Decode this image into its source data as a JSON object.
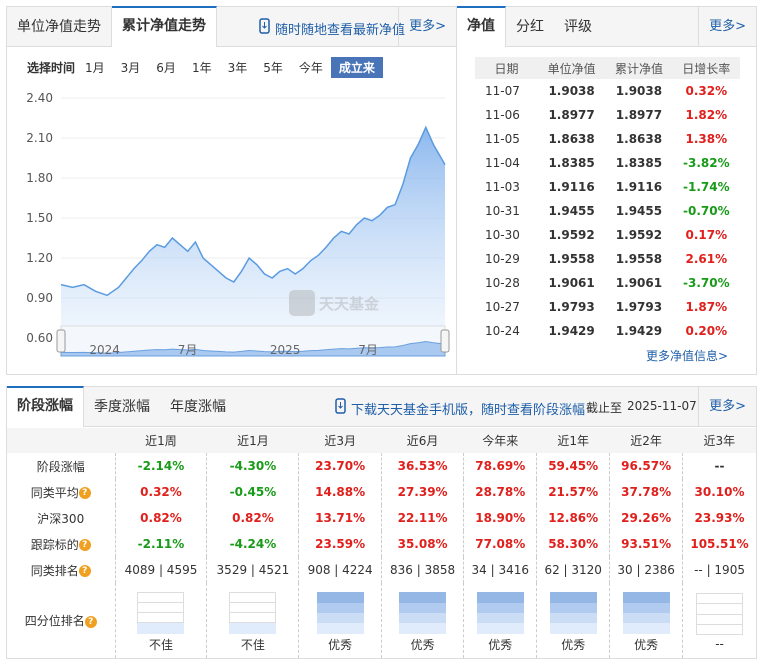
{
  "left": {
    "tabs": [
      "单位净值走势",
      "累计净值走势"
    ],
    "active_tab": 1,
    "app_link": "随时随地查看最新净值",
    "more": "更多>",
    "range_label": "选择时间",
    "ranges": [
      "1月",
      "3月",
      "6月",
      "1年",
      "3年",
      "5年",
      "今年",
      "成立来"
    ],
    "selected_range": "成立来",
    "watermark": "天天基金"
  },
  "chart_data": {
    "type": "area",
    "title": "累计净值走势",
    "yticks": [
      "2.40",
      "2.10",
      "1.80",
      "1.50",
      "1.20",
      "0.90",
      "0.60"
    ],
    "ylim": [
      0.6,
      2.4
    ],
    "navigator_labels": [
      "2024",
      "7月",
      "2025",
      "7月"
    ],
    "x": [
      0,
      3,
      6,
      9,
      12,
      15,
      17,
      19,
      21,
      23,
      25,
      27,
      29,
      31,
      33,
      35,
      37,
      39,
      41,
      43,
      45,
      47,
      49,
      51,
      53,
      55,
      57,
      59,
      61,
      63,
      65,
      67,
      69,
      71,
      73,
      75,
      77,
      79,
      81,
      83,
      85,
      87,
      89,
      91,
      93,
      95,
      97,
      99,
      100
    ],
    "values": [
      1.0,
      0.98,
      1.0,
      0.95,
      0.92,
      0.98,
      1.05,
      1.12,
      1.18,
      1.25,
      1.3,
      1.28,
      1.35,
      1.3,
      1.25,
      1.32,
      1.2,
      1.15,
      1.1,
      1.05,
      1.02,
      1.1,
      1.2,
      1.15,
      1.08,
      1.05,
      1.1,
      1.12,
      1.08,
      1.12,
      1.18,
      1.22,
      1.28,
      1.35,
      1.4,
      1.38,
      1.45,
      1.5,
      1.48,
      1.52,
      1.58,
      1.6,
      1.75,
      1.95,
      2.05,
      2.18,
      2.05,
      1.95,
      1.9
    ]
  },
  "right": {
    "tabs": [
      "净值",
      "分红",
      "评级"
    ],
    "active_tab": 0,
    "more": "更多>",
    "headers": [
      "日期",
      "单位净值",
      "累计净值",
      "日增长率"
    ],
    "rows": [
      [
        "11-07",
        "1.9038",
        "1.9038",
        "0.32%"
      ],
      [
        "11-06",
        "1.8977",
        "1.8977",
        "1.82%"
      ],
      [
        "11-05",
        "1.8638",
        "1.8638",
        "1.38%"
      ],
      [
        "11-04",
        "1.8385",
        "1.8385",
        "-3.82%"
      ],
      [
        "11-03",
        "1.9116",
        "1.9116",
        "-1.74%"
      ],
      [
        "10-31",
        "1.9455",
        "1.9455",
        "-0.70%"
      ],
      [
        "10-30",
        "1.9592",
        "1.9592",
        "0.17%"
      ],
      [
        "10-29",
        "1.9558",
        "1.9558",
        "2.61%"
      ],
      [
        "10-28",
        "1.9061",
        "1.9061",
        "-3.70%"
      ],
      [
        "10-27",
        "1.9793",
        "1.9793",
        "1.87%"
      ],
      [
        "10-24",
        "1.9429",
        "1.9429",
        "0.20%"
      ]
    ],
    "more_nav": "更多净值信息>"
  },
  "bottom": {
    "tabs": [
      "阶段涨幅",
      "季度涨幅",
      "年度涨幅"
    ],
    "active_tab": 0,
    "app_link": "下载天天基金手机版，随时查看阶段涨幅",
    "as_of_label": "截止至",
    "as_of": "2025-11-07",
    "more": "更多>",
    "headers": [
      "",
      "近1周",
      "近1月",
      "近3月",
      "近6月",
      "今年来",
      "近1年",
      "近2年",
      "近3年"
    ],
    "rows": [
      {
        "label": "阶段涨幅",
        "help": false,
        "values": [
          "-2.14%",
          "-4.30%",
          "23.70%",
          "36.53%",
          "78.69%",
          "59.45%",
          "96.57%",
          "--"
        ]
      },
      {
        "label": "同类平均",
        "help": true,
        "values": [
          "0.32%",
          "-0.45%",
          "14.88%",
          "27.39%",
          "28.78%",
          "21.57%",
          "37.78%",
          "30.10%"
        ]
      },
      {
        "label": "沪深300",
        "help": false,
        "values": [
          "0.82%",
          "0.82%",
          "13.71%",
          "22.11%",
          "18.90%",
          "12.86%",
          "29.26%",
          "23.93%"
        ]
      },
      {
        "label": "跟踪标的",
        "help": true,
        "values": [
          "-2.11%",
          "-4.24%",
          "23.59%",
          "35.08%",
          "77.08%",
          "58.30%",
          "93.51%",
          "105.51%"
        ]
      },
      {
        "label": "同类排名",
        "help": true,
        "values": [
          "4089 | 4595",
          "3529 | 4521",
          "908 | 4224",
          "836 | 3858",
          "34 | 3416",
          "62 | 3120",
          "30 | 2386",
          "-- | 1905"
        ]
      }
    ],
    "quartile_label": "四分位排名",
    "quartile_levels": [
      1,
      1,
      4,
      4,
      4,
      4,
      4,
      0
    ],
    "quartile_text": [
      "不佳",
      "不佳",
      "优秀",
      "优秀",
      "优秀",
      "优秀",
      "优秀",
      "--"
    ],
    "help_glyph": "?"
  },
  "colors": {
    "accent": "#1f5fa8",
    "up": "#e0201c",
    "down": "#189b18"
  }
}
